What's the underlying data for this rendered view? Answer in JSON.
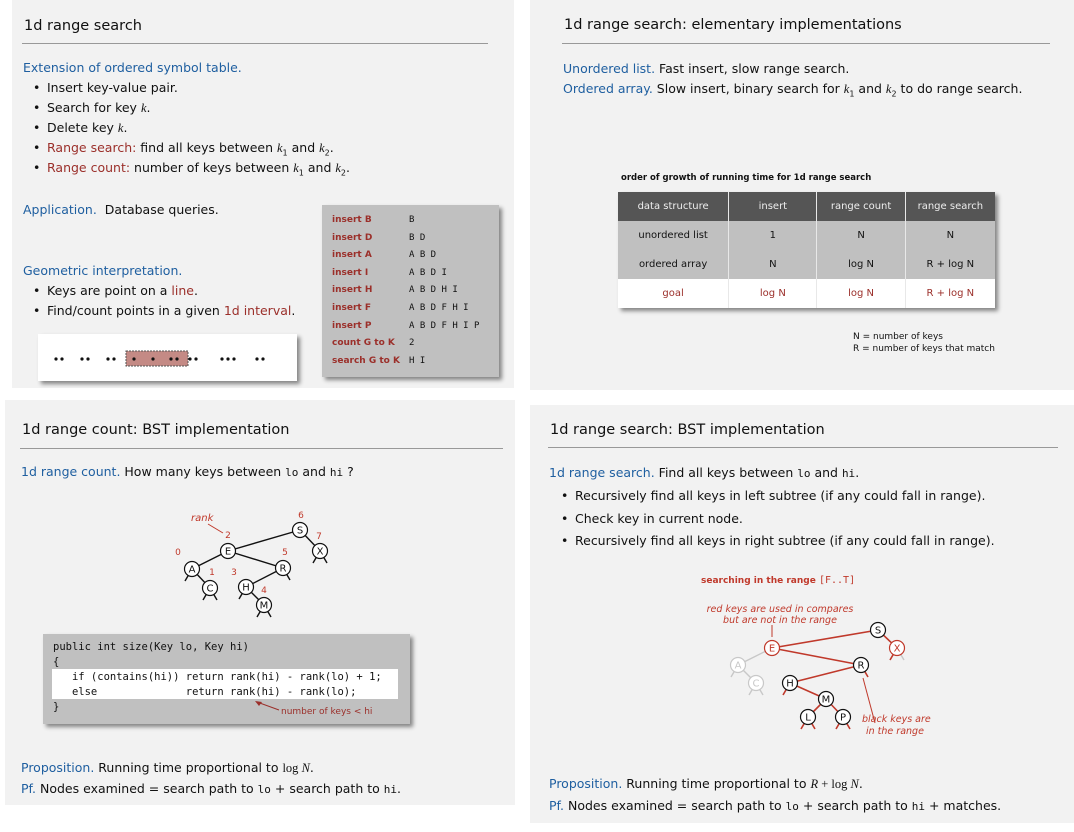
{
  "slide1": {
    "title": "1d range search",
    "ext_heading": "Extension of ordered symbol table.",
    "bullets": [
      {
        "text": "Insert key-value pair."
      },
      {
        "text": "Search for key ",
        "var": "k",
        "end": "."
      },
      {
        "text": "Delete key ",
        "var": "k",
        "end": "."
      },
      {
        "label": "Range search:",
        "text": "  find all keys between ",
        "v1": "k",
        "s1": "1",
        "mid": " and ",
        "v2": "k",
        "s2": "2",
        "end": "."
      },
      {
        "label": "Range count:",
        "text": "  number of keys between ",
        "v1": "k",
        "s1": "1",
        "mid": " and ",
        "v2": "k",
        "s2": "2",
        "end": "."
      }
    ],
    "app_label": "Application.",
    "app_text": "Database queries.",
    "geo_heading": "Geometric interpretation.",
    "geo1_a": "Keys are point on a ",
    "geo1_red": "line",
    "geo1_b": ".",
    "geo2_a": "Find/count points in a given ",
    "geo2_red": "1d interval",
    "geo2_b": ".",
    "ops": [
      {
        "op": "insert B",
        "result": "B"
      },
      {
        "op": "insert D",
        "result": "B D"
      },
      {
        "op": "insert A",
        "result": "A B D"
      },
      {
        "op": "insert I",
        "result": "A B D I"
      },
      {
        "op": "insert H",
        "result": "A B D H I"
      },
      {
        "op": "insert F",
        "result": "A B D F H I"
      },
      {
        "op": "insert P",
        "result": "A B D F H I P"
      },
      {
        "op": "count G to K",
        "result": "2"
      },
      {
        "op": "search G to K",
        "result": "H I"
      }
    ]
  },
  "slide2": {
    "title": "1d range search:  elementary implementations",
    "l1_label": "Unordered list.",
    "l1_text": "  Fast insert, slow range search.",
    "l2_label": "Ordered array.",
    "l2_a": "  Slow insert, binary search for ",
    "l2_v1": "k",
    "l2_s1": "1",
    "l2_mid": " and ",
    "l2_v2": "k",
    "l2_s2": "2",
    "l2_b": " to do range search.",
    "table_caption": "order of growth of running time for 1d range search",
    "table": {
      "headers": [
        "data structure",
        "insert",
        "range count",
        "range search"
      ],
      "rows": [
        [
          "unordered list",
          "1",
          "N",
          "N"
        ],
        [
          "ordered array",
          "N",
          "log N",
          "R + log N"
        ],
        [
          "goal",
          "log N",
          "log N",
          "R + log N"
        ]
      ]
    },
    "note1": "N = number of keys",
    "note2": "R = number of keys that match"
  },
  "slide3": {
    "title": "1d range count:  BST implementation",
    "intro_label": "1d range count.",
    "intro_a": "  How many keys between ",
    "intro_lo": "lo",
    "intro_mid": " and ",
    "intro_hi": "hi",
    "intro_b": " ?",
    "tree": {
      "rank_label": "rank",
      "nodes": [
        "S",
        "X",
        "E",
        "A",
        "C",
        "R",
        "H",
        "M"
      ],
      "ranks": [
        "6",
        "7",
        "2",
        "0",
        "1",
        "5",
        "3",
        "4"
      ]
    },
    "code": [
      "public int size(Key lo, Key hi)",
      "{",
      "   if (contains(hi)) return rank(hi) - rank(lo) + 1;",
      "   else              return rank(hi) - rank(lo);",
      "}"
    ],
    "code_note": "number of keys < hi",
    "prop_label": "Proposition.",
    "prop_a": "  Running time proportional to ",
    "prop_log": "log ",
    "prop_n": "N",
    "prop_b": ".",
    "pf_label": "Pf.",
    "pf_a": "  Nodes examined = search path to ",
    "pf_lo": "lo",
    "pf_mid": " + search path to ",
    "pf_hi": "hi",
    "pf_b": "."
  },
  "slide4": {
    "title": "1d range search:  BST implementation",
    "intro_label": "1d range search.",
    "intro_a": "  Find all keys between ",
    "intro_lo": "lo",
    "intro_mid": " and ",
    "intro_hi": "hi",
    "intro_b": ".",
    "bullets": [
      "Recursively find all keys in left subtree (if any could fall in range).",
      "Check key in current node.",
      "Recursively find all keys in right subtree (if any could fall in range)."
    ],
    "fig_caption": "searching in the range ",
    "fig_range": "[F..T]",
    "red_note1": "red keys are used in compares",
    "red_note2": "but are not in the range",
    "black_note1": "black keys are",
    "black_note2": "in the range",
    "tree": {
      "nodes": [
        "S",
        "X",
        "E",
        "A",
        "C",
        "R",
        "H",
        "M",
        "L",
        "P"
      ]
    },
    "prop_label": "Proposition.",
    "prop_a": "  Running time proportional to ",
    "prop_r": "R",
    "prop_mid": " + log ",
    "prop_n": "N",
    "prop_b": ".",
    "pf_label": "Pf.",
    "pf_a": "  Nodes examined = search path to ",
    "pf_lo": "lo",
    "pf_mid": " + search path to ",
    "pf_hi": "hi",
    "pf_b": " +  matches."
  },
  "colors": {
    "blue": "#1f5fa0",
    "red": "#9b2f2a",
    "slide_bg": "#f2f2f2",
    "box_grey": "#c0c0c0",
    "table_header": "#555555"
  }
}
